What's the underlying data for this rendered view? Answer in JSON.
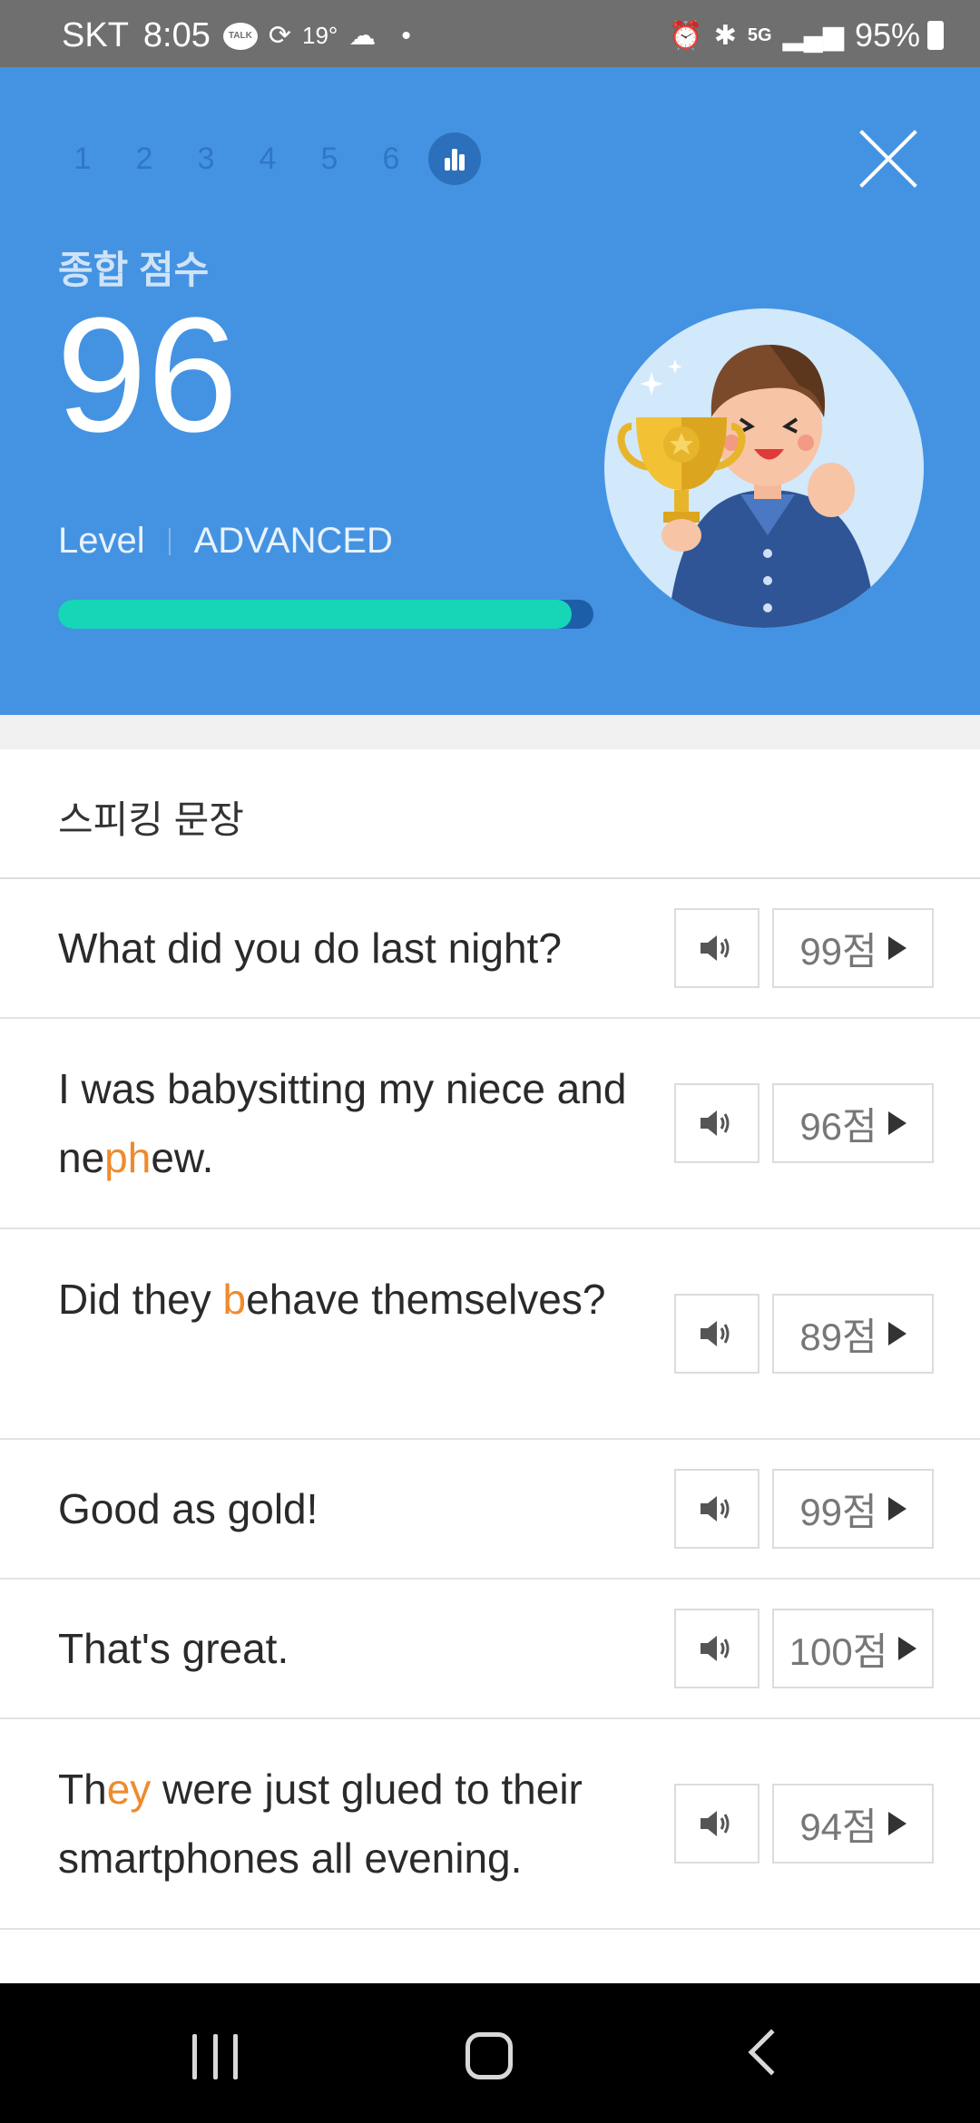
{
  "status_bar": {
    "carrier": "SKT",
    "time": "8:05",
    "talk_icon_text": "TALK",
    "temperature": "19°",
    "network": "5G",
    "battery": "95%"
  },
  "header": {
    "steps": [
      "1",
      "2",
      "3",
      "4",
      "5",
      "6"
    ],
    "total_label": "종합 점수",
    "total_score": "96",
    "level_label": "Level",
    "level_value": "ADVANCED",
    "progress_fraction": 0.96
  },
  "section": {
    "title": "스피킹 문장"
  },
  "sentences": [
    {
      "parts": [
        {
          "t": "What did you do last night?"
        }
      ],
      "score": "99점"
    },
    {
      "parts": [
        {
          "t": "I was babysitting my niece and ne"
        },
        {
          "t": "ph",
          "hl": true
        },
        {
          "t": "ew."
        }
      ],
      "score": "96점"
    },
    {
      "parts": [
        {
          "t": "Did they "
        },
        {
          "t": "b",
          "hl": true
        },
        {
          "t": "ehave themselves?"
        }
      ],
      "score": "89점"
    },
    {
      "parts": [
        {
          "t": "Good as gold!"
        }
      ],
      "score": "99점"
    },
    {
      "parts": [
        {
          "t": "That's great."
        }
      ],
      "score": "100점"
    },
    {
      "parts": [
        {
          "t": "Th"
        },
        {
          "t": "ey",
          "hl": true
        },
        {
          "t": " were just glued to their smartphones all evening."
        }
      ],
      "score": "94점"
    }
  ],
  "colors": {
    "header_bg": "#4493e2",
    "highlight": "#f08a2b",
    "progress": "#17d6b8"
  }
}
